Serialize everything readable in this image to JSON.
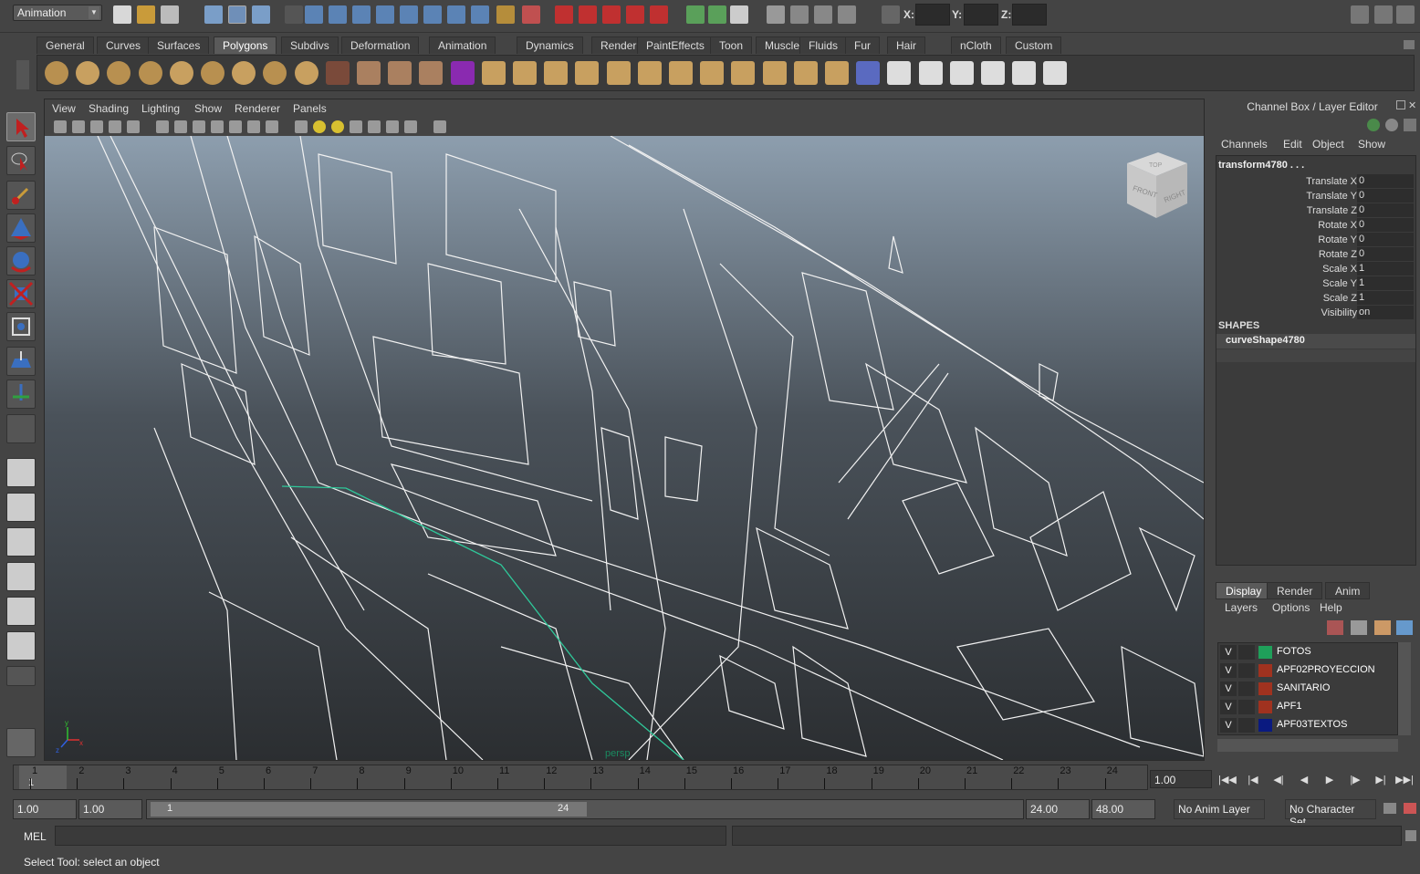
{
  "menu_mode": "Animation",
  "coords": {
    "x_label": "X:",
    "y_label": "Y:",
    "z_label": "Z:",
    "x": "",
    "y": "",
    "z": ""
  },
  "shelf_tabs": [
    "General",
    "Curves",
    "Surfaces",
    "Polygons",
    "Subdivs",
    "Deformation",
    "Animation",
    "Dynamics",
    "Rendering",
    "PaintEffects",
    "Toon",
    "Muscle",
    "Fluids",
    "Fur",
    "Hair",
    "nCloth",
    "Custom"
  ],
  "shelf_active": "Polygons",
  "viewport": {
    "menus": [
      "View",
      "Shading",
      "Lighting",
      "Show",
      "Renderer",
      "Panels"
    ],
    "camera_label": "persp",
    "viewcube": {
      "front": "FRONT",
      "right": "RIGHT",
      "top": "TOP"
    },
    "axis": {
      "x": "x",
      "y": "y",
      "z": "z"
    }
  },
  "channel_box": {
    "title": "Channel Box / Layer Editor",
    "menus": [
      "Channels",
      "Edit",
      "Object",
      "Show"
    ],
    "object_name": "transform4780 . . .",
    "channels": [
      {
        "label": "Translate X",
        "value": "0"
      },
      {
        "label": "Translate Y",
        "value": "0"
      },
      {
        "label": "Translate Z",
        "value": "0"
      },
      {
        "label": "Rotate X",
        "value": "0"
      },
      {
        "label": "Rotate Y",
        "value": "0"
      },
      {
        "label": "Rotate Z",
        "value": "0"
      },
      {
        "label": "Scale X",
        "value": "1"
      },
      {
        "label": "Scale Y",
        "value": "1"
      },
      {
        "label": "Scale Z",
        "value": "1"
      },
      {
        "label": "Visibility",
        "value": "on"
      }
    ],
    "shapes_header": "SHAPES",
    "shape_name": "curveShape4780"
  },
  "layer_editor": {
    "tabs": [
      "Display",
      "Render",
      "Anim"
    ],
    "active_tab": "Display",
    "menus": [
      "Layers",
      "Options",
      "Help"
    ],
    "layers": [
      {
        "v": "V",
        "name": "FOTOS",
        "color": "#1fa05a"
      },
      {
        "v": "V",
        "name": "APF02PROYECCION",
        "color": "#a0321f"
      },
      {
        "v": "V",
        "name": "SANITARIO",
        "color": "#a0321f"
      },
      {
        "v": "V",
        "name": "APF1",
        "color": "#a0321f"
      },
      {
        "v": "V",
        "name": "APF03TEXTOS",
        "color": "#0a1a80"
      }
    ]
  },
  "timeline": {
    "ticks": [
      "1",
      "2",
      "3",
      "4",
      "5",
      "6",
      "7",
      "8",
      "9",
      "10",
      "11",
      "12",
      "13",
      "14",
      "15",
      "16",
      "17",
      "18",
      "19",
      "20",
      "21",
      "22",
      "23",
      "24"
    ],
    "current_frame_marker": "1",
    "current_time": "1.00"
  },
  "range": {
    "start": "1.00",
    "playback_start": "1.00",
    "slider_start": "1",
    "slider_end": "24",
    "playback_end": "24.00",
    "end": "48.00",
    "anim_layer": "No Anim Layer",
    "character_set": "No Character Set"
  },
  "command": {
    "label": "MEL",
    "input": ""
  },
  "status": "Select Tool: select an object"
}
